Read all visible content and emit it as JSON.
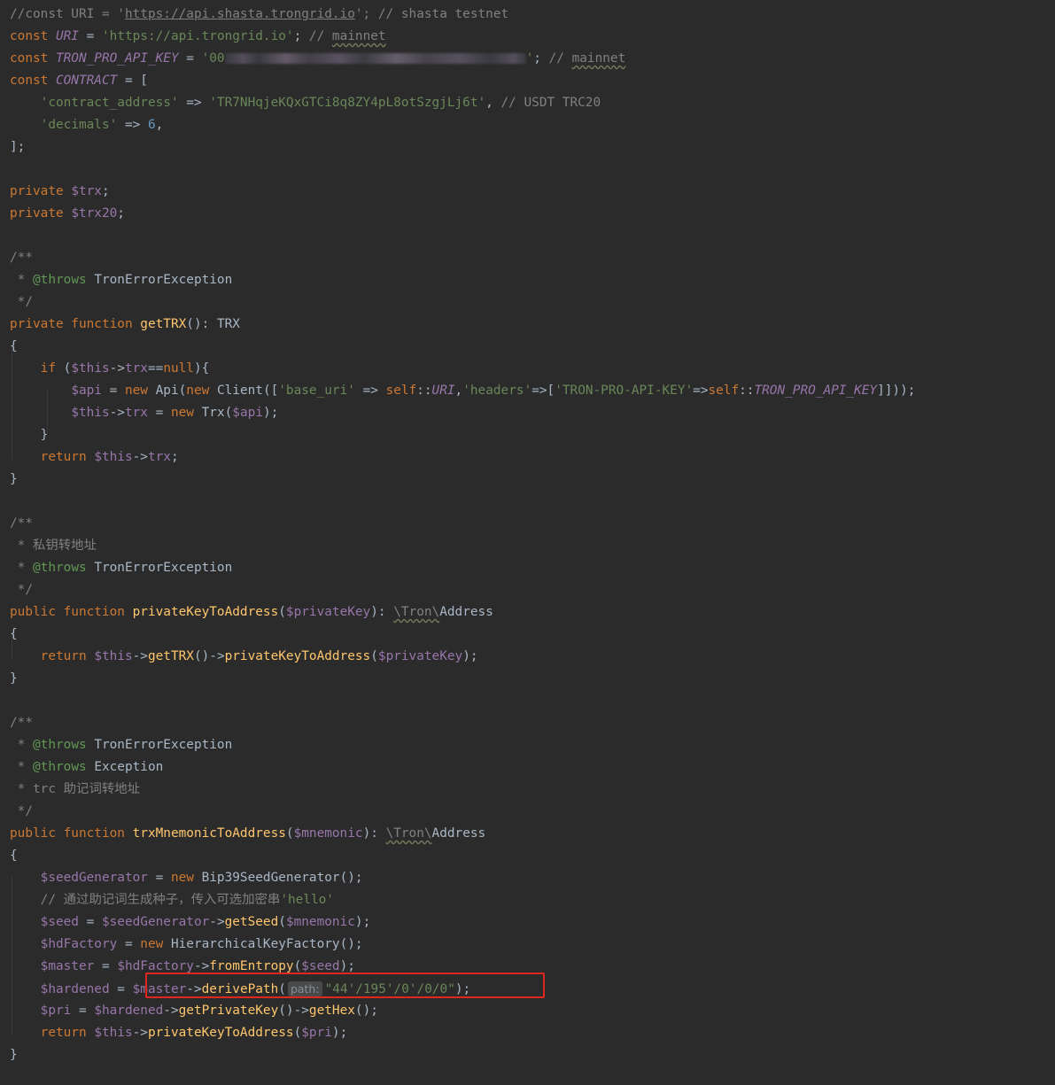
{
  "editor": {
    "lines": [
      [
        [
          "c",
          "//const URI = '"
        ],
        [
          "c u",
          "https://api.shasta.trongrid.io"
        ],
        [
          "c",
          "'; // shasta testnet"
        ]
      ],
      [
        [
          "k",
          "const "
        ],
        [
          "cs",
          "URI"
        ],
        [
          "p",
          " = "
        ],
        [
          "s",
          "'https://api.trongrid.io'"
        ],
        [
          "p",
          "; "
        ],
        [
          "c",
          "// "
        ],
        [
          "c wave",
          "mainnet"
        ]
      ],
      [
        [
          "k",
          "const "
        ],
        [
          "cs",
          "TRON_PRO_API_KEY"
        ],
        [
          "p",
          " = "
        ],
        [
          "s",
          "'00"
        ],
        [
          "blur",
          ""
        ],
        [
          "s",
          "'"
        ],
        [
          "p",
          "; "
        ],
        [
          "c",
          "// "
        ],
        [
          "c wave",
          "mainnet"
        ]
      ],
      [
        [
          "k",
          "const "
        ],
        [
          "cs",
          "CONTRACT"
        ],
        [
          "p",
          " = ["
        ]
      ],
      [
        [
          "p",
          "    "
        ],
        [
          "s",
          "'contract_address'"
        ],
        [
          "p",
          " => "
        ],
        [
          "s",
          "'TR7NHqjeKQxGTCi8q8ZY4pL8otSzgjLj6t'"
        ],
        [
          "p",
          ", "
        ],
        [
          "c",
          "// USDT TRC20"
        ]
      ],
      [
        [
          "p",
          "    "
        ],
        [
          "s",
          "'decimals'"
        ],
        [
          "p",
          " => "
        ],
        [
          "n",
          "6"
        ],
        [
          "p",
          ","
        ]
      ],
      [
        [
          "p",
          "];"
        ]
      ],
      [],
      [
        [
          "k",
          "private "
        ],
        [
          "v",
          "$trx"
        ],
        [
          "p",
          ";"
        ]
      ],
      [
        [
          "k",
          "private "
        ],
        [
          "v",
          "$trx20"
        ],
        [
          "p",
          ";"
        ]
      ],
      [],
      [
        [
          "c",
          "/**"
        ]
      ],
      [
        [
          "c",
          " * "
        ],
        [
          "tag",
          "@throws "
        ],
        [
          "cls",
          "TronErrorException"
        ]
      ],
      [
        [
          "c",
          " */"
        ]
      ],
      [
        [
          "k",
          "private function "
        ],
        [
          "f",
          "getTRX"
        ],
        [
          "p",
          "(): "
        ],
        [
          "cls",
          "TRX"
        ]
      ],
      [
        [
          "p",
          "{"
        ]
      ],
      [
        [
          "p",
          "    "
        ],
        [
          "k",
          "if "
        ],
        [
          "p",
          "("
        ],
        [
          "v",
          "$this"
        ],
        [
          "p",
          "->"
        ],
        [
          "v",
          "trx"
        ],
        [
          "p",
          "=="
        ],
        [
          "k",
          "null"
        ],
        [
          "p",
          "){"
        ]
      ],
      [
        [
          "p",
          "        "
        ],
        [
          "v",
          "$api"
        ],
        [
          "p",
          " = "
        ],
        [
          "k",
          "new "
        ],
        [
          "cls",
          "Api"
        ],
        [
          "p",
          "("
        ],
        [
          "k",
          "new "
        ],
        [
          "cls",
          "Client"
        ],
        [
          "p",
          "(["
        ],
        [
          "s",
          "'base_uri'"
        ],
        [
          "p",
          " => "
        ],
        [
          "k",
          "self"
        ],
        [
          "p",
          "::"
        ],
        [
          "cs",
          "URI"
        ],
        [
          "p",
          ","
        ],
        [
          "s",
          "'headers'"
        ],
        [
          "p",
          "=>["
        ],
        [
          "s",
          "'TRON-PRO-API-KEY'"
        ],
        [
          "p",
          "=>"
        ],
        [
          "k",
          "self"
        ],
        [
          "p",
          "::"
        ],
        [
          "cs",
          "TRON_PRO_API_KEY"
        ],
        [
          "p",
          "]]));"
        ]
      ],
      [
        [
          "p",
          "        "
        ],
        [
          "v",
          "$this"
        ],
        [
          "p",
          "->"
        ],
        [
          "v",
          "trx"
        ],
        [
          "p",
          " = "
        ],
        [
          "k",
          "new "
        ],
        [
          "cls",
          "Trx"
        ],
        [
          "p",
          "("
        ],
        [
          "v",
          "$api"
        ],
        [
          "p",
          ");"
        ]
      ],
      [
        [
          "p",
          "    }"
        ]
      ],
      [
        [
          "p",
          "    "
        ],
        [
          "k",
          "return "
        ],
        [
          "v",
          "$this"
        ],
        [
          "p",
          "->"
        ],
        [
          "v",
          "trx"
        ],
        [
          "p",
          ";"
        ]
      ],
      [
        [
          "p",
          "}"
        ]
      ],
      [],
      [
        [
          "c",
          "/**"
        ]
      ],
      [
        [
          "c",
          " * "
        ],
        [
          "c cjk",
          "私钥转地址"
        ]
      ],
      [
        [
          "c",
          " * "
        ],
        [
          "tag",
          "@throws "
        ],
        [
          "cls",
          "TronErrorException"
        ]
      ],
      [
        [
          "c",
          " */"
        ]
      ],
      [
        [
          "k",
          "public function "
        ],
        [
          "f",
          "privateKeyToAddress"
        ],
        [
          "p",
          "("
        ],
        [
          "v",
          "$privateKey"
        ],
        [
          "p",
          "): "
        ],
        [
          "c wave",
          "\\Tron\\"
        ],
        [
          "cls",
          "Address"
        ]
      ],
      [
        [
          "p",
          "{"
        ]
      ],
      [
        [
          "p",
          "    "
        ],
        [
          "k",
          "return "
        ],
        [
          "v",
          "$this"
        ],
        [
          "p",
          "->"
        ],
        [
          "f",
          "getTRX"
        ],
        [
          "p",
          "()->"
        ],
        [
          "f",
          "privateKeyToAddress"
        ],
        [
          "p",
          "("
        ],
        [
          "v",
          "$privateKey"
        ],
        [
          "p",
          ");"
        ]
      ],
      [
        [
          "p",
          "}"
        ]
      ],
      [],
      [
        [
          "c",
          "/**"
        ]
      ],
      [
        [
          "c",
          " * "
        ],
        [
          "tag",
          "@throws "
        ],
        [
          "cls",
          "TronErrorException"
        ]
      ],
      [
        [
          "c",
          " * "
        ],
        [
          "tag",
          "@throws "
        ],
        [
          "cls",
          "Exception"
        ]
      ],
      [
        [
          "c",
          " * trc "
        ],
        [
          "c cjk",
          "助记词转地址"
        ]
      ],
      [
        [
          "c",
          " */"
        ]
      ],
      [
        [
          "k",
          "public function "
        ],
        [
          "f",
          "trxMnemonicToAddress"
        ],
        [
          "p",
          "("
        ],
        [
          "v",
          "$mnemonic"
        ],
        [
          "p",
          "): "
        ],
        [
          "c wave",
          "\\Tron\\"
        ],
        [
          "cls",
          "Address"
        ]
      ],
      [
        [
          "p",
          "{"
        ]
      ],
      [
        [
          "p",
          "    "
        ],
        [
          "v",
          "$seedGenerator"
        ],
        [
          "p",
          " = "
        ],
        [
          "k",
          "new "
        ],
        [
          "cls",
          "Bip39SeedGenerator"
        ],
        [
          "p",
          "();"
        ]
      ],
      [
        [
          "p",
          "    "
        ],
        [
          "c",
          "// "
        ],
        [
          "c cjk",
          "通过助记词生成种子，传入可选加密串"
        ],
        [
          "s",
          "'hello'"
        ]
      ],
      [
        [
          "p",
          "    "
        ],
        [
          "v",
          "$seed"
        ],
        [
          "p",
          " = "
        ],
        [
          "v",
          "$seedGenerator"
        ],
        [
          "p",
          "->"
        ],
        [
          "f",
          "getSeed"
        ],
        [
          "p",
          "("
        ],
        [
          "v",
          "$mnemonic"
        ],
        [
          "p",
          ");"
        ]
      ],
      [
        [
          "p",
          "    "
        ],
        [
          "v",
          "$hdFactory"
        ],
        [
          "p",
          " = "
        ],
        [
          "k",
          "new "
        ],
        [
          "cls",
          "HierarchicalKeyFactory"
        ],
        [
          "p",
          "();"
        ]
      ],
      [
        [
          "p",
          "    "
        ],
        [
          "v",
          "$master"
        ],
        [
          "p",
          " = "
        ],
        [
          "v",
          "$hdFactory"
        ],
        [
          "p",
          "->"
        ],
        [
          "f",
          "fromEntropy"
        ],
        [
          "p",
          "("
        ],
        [
          "v",
          "$seed"
        ],
        [
          "p",
          ");"
        ]
      ],
      [
        [
          "p",
          "    "
        ],
        [
          "v",
          "$hardened"
        ],
        [
          "p",
          " = "
        ],
        [
          "v",
          "$master"
        ],
        [
          "p",
          "->"
        ],
        [
          "f",
          "derivePath"
        ],
        [
          "p",
          "("
        ],
        [
          "hint",
          "path:"
        ],
        [
          "s",
          "\"44'/195'/0'/0/0\""
        ],
        [
          "p",
          ");"
        ]
      ],
      [
        [
          "p",
          "    "
        ],
        [
          "v",
          "$pri"
        ],
        [
          "p",
          " = "
        ],
        [
          "v",
          "$hardened"
        ],
        [
          "p",
          "->"
        ],
        [
          "f",
          "getPrivateKey"
        ],
        [
          "p",
          "()->"
        ],
        [
          "f",
          "getHex"
        ],
        [
          "p",
          "();"
        ]
      ],
      [
        [
          "p",
          "    "
        ],
        [
          "k",
          "return "
        ],
        [
          "v",
          "$this"
        ],
        [
          "p",
          "->"
        ],
        [
          "f",
          "privateKeyToAddress"
        ],
        [
          "p",
          "("
        ],
        [
          "v",
          "$pri"
        ],
        [
          "p",
          ");"
        ]
      ],
      [
        [
          "p",
          "}"
        ]
      ]
    ]
  },
  "colors": {
    "background": "#2b2b2b",
    "comment": "#808080",
    "keyword": "#cc7832",
    "string": "#6a8759",
    "variable": "#9876aa",
    "function": "#ffc66d",
    "number": "#6897bb",
    "doc_tag": "#629755",
    "highlight_border": "#e0271f"
  }
}
